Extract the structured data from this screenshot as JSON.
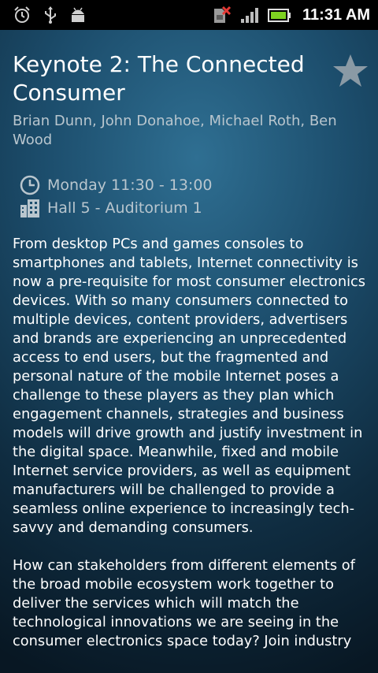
{
  "status_bar": {
    "time": "11:31 AM",
    "left_icons": [
      "alarm-icon",
      "usb-icon",
      "android-debug-icon"
    ],
    "right_icons": [
      "no-sim-icon",
      "signal-icon",
      "battery-icon"
    ]
  },
  "session": {
    "title": "Keynote 2: The Connected Consumer",
    "speakers": "Brian Dunn, John Donahoe, Michael Roth, Ben Wood",
    "time": "Monday 11:30 - 13:00",
    "location": "Hall 5 - Auditorium 1",
    "starred": false,
    "description": [
      "From desktop PCs and games consoles to smartphones and tablets, Internet connectivity is now a pre-requisite for most consumer electronics devices. With so many consumers connected to multiple devices, content providers, advertisers and brands are experiencing an unprecedented access to end users, but the fragmented and personal nature of the mobile Internet poses a challenge to these players as they plan which engagement channels, strategies and business models will drive growth and justify investment in the digital space. Meanwhile, fixed and mobile Internet service providers, as well as equipment manufacturers will be challenged to provide a seamless online experience to increasingly tech-savvy and demanding consumers.",
      "How can stakeholders from different elements of the broad mobile ecosystem work together to deliver the services which will match the technological innovations we are seeing in the consumer electronics space today? Join industry"
    ]
  },
  "colors": {
    "status_bar_bg": "#000000",
    "title": "#ffffff",
    "secondary_text": "#b9c6ce",
    "star": "#8a9aa5",
    "battery": "#7ed321",
    "no_sim_x": "#e53935"
  }
}
